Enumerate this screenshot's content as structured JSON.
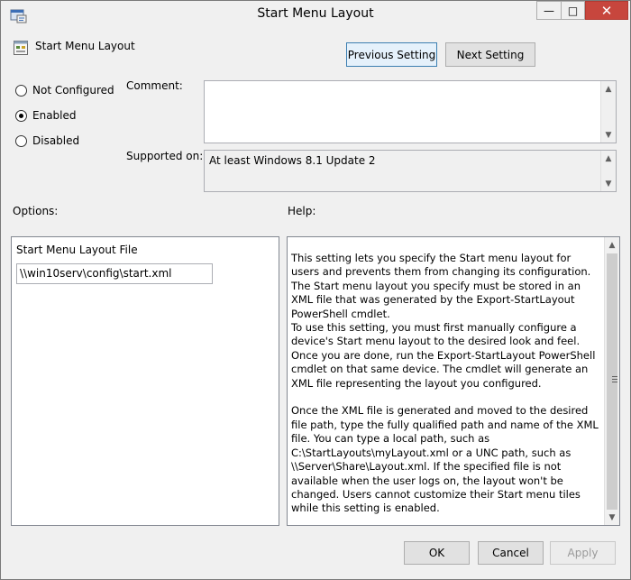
{
  "window": {
    "title": "Start Menu Layout",
    "minimize_glyph": "—",
    "maximize_glyph": "□",
    "close_glyph": "✕"
  },
  "header": {
    "policy_name": "Start Menu Layout",
    "previous_label": "Previous Setting",
    "next_label": "Next Setting"
  },
  "state": {
    "options": [
      {
        "label": "Not Configured",
        "selected": false
      },
      {
        "label": "Enabled",
        "selected": true
      },
      {
        "label": "Disabled",
        "selected": false
      }
    ]
  },
  "comment": {
    "label": "Comment:",
    "value": ""
  },
  "supported": {
    "label": "Supported on:",
    "value": "At least Windows 8.1 Update 2"
  },
  "options_section": {
    "label": "Options:",
    "file_label": "Start Menu Layout File",
    "file_value": "\\\\win10serv\\config\\start.xml"
  },
  "help_section": {
    "label": "Help:",
    "text": "This setting lets you specify the Start menu layout for users and prevents them from changing its configuration. The Start menu layout you specify must be stored in an XML file that was generated by the Export-StartLayout PowerShell cmdlet.\nTo use this setting, you must first manually configure a device's Start menu layout to the desired look and feel. Once you are done, run the Export-StartLayout PowerShell cmdlet on that same device. The cmdlet will generate an XML file representing the layout you configured.\n\nOnce the XML file is generated and moved to the desired file path, type the fully qualified path and name of the XML file. You can type a local path, such as C:\\StartLayouts\\myLayout.xml or a UNC path, such as \\\\Server\\Share\\Layout.xml. If the specified file is not available when the user logs on, the layout won't be changed. Users cannot customize their Start menu tiles while this setting is enabled.\n\nIf you disable this setting or do not configure it, the Start menu layout won't be changed and users will be able to customize it."
  },
  "footer": {
    "ok_label": "OK",
    "cancel_label": "Cancel",
    "apply_label": "Apply"
  },
  "icons": {
    "app": "policy-window-icon",
    "policy": "policy-setting-icon",
    "scroll_up": "▲",
    "scroll_down": "▼"
  }
}
